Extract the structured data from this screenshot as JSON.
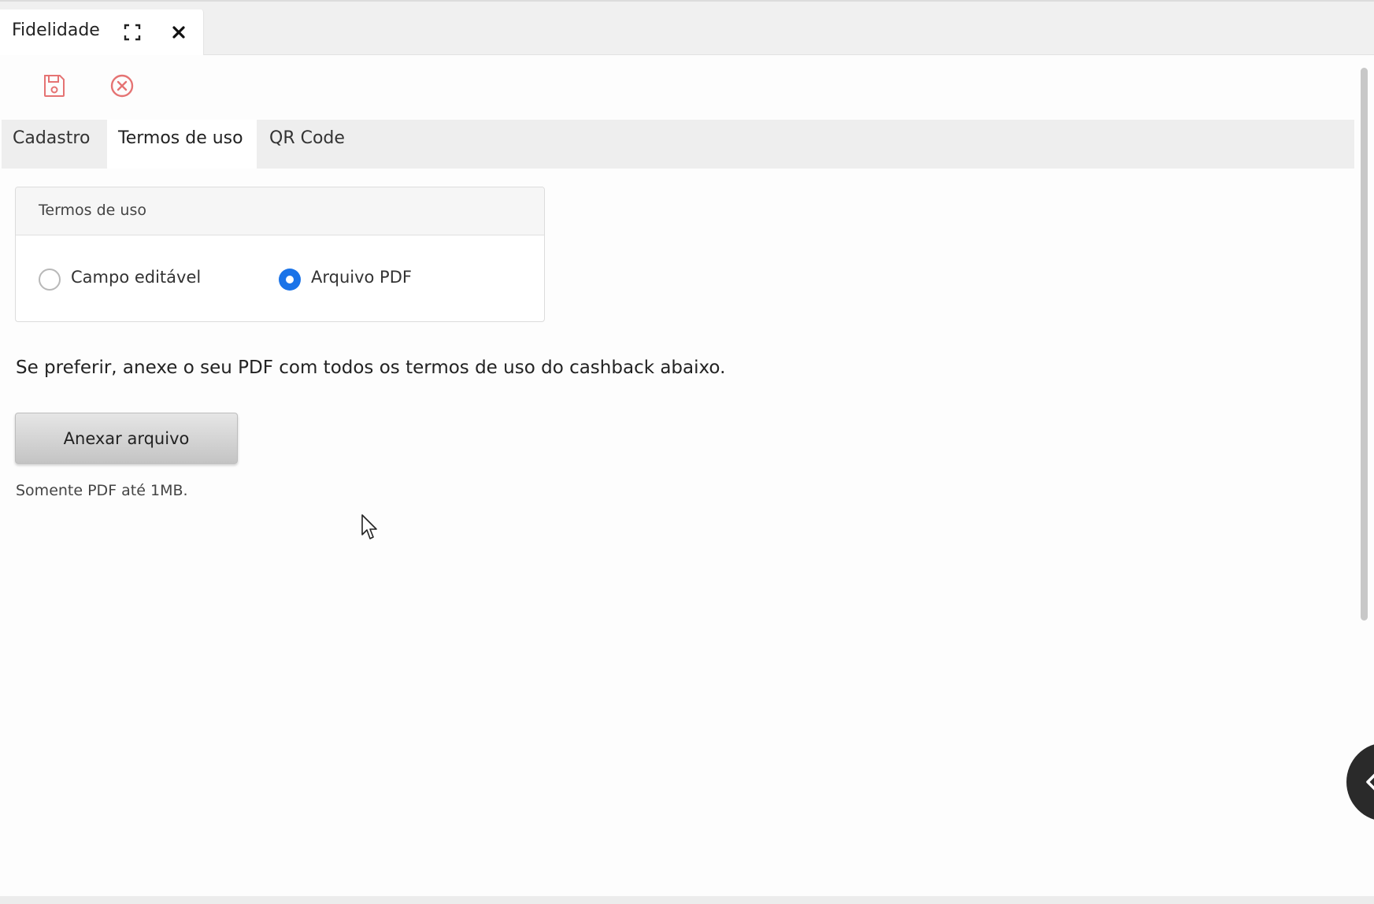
{
  "window": {
    "tab_title": "Fidelidade",
    "icons": {
      "expand": "expand-icon",
      "close": "close-icon"
    }
  },
  "toolbar": {
    "icons": {
      "save": "save-icon",
      "cancel": "cancel-icon"
    },
    "accent_color": "#e57373"
  },
  "tabs": [
    {
      "label": "Cadastro",
      "active": false
    },
    {
      "label": "Termos de uso",
      "active": true
    },
    {
      "label": "QR Code",
      "active": false
    }
  ],
  "terms_panel": {
    "title": "Termos de uso",
    "options": [
      {
        "label": "Campo editável",
        "checked": false
      },
      {
        "label": "Arquivo PDF",
        "checked": true
      }
    ],
    "radio_color": "#1a73e8"
  },
  "attachment": {
    "description": "Se preferir, anexe o seu PDF com todos os termos de uso do cashback abaixo.",
    "button_label": "Anexar arquivo",
    "hint": "Somente PDF até 1MB."
  },
  "side_toggle": {
    "icon": "chevron-left-icon"
  }
}
